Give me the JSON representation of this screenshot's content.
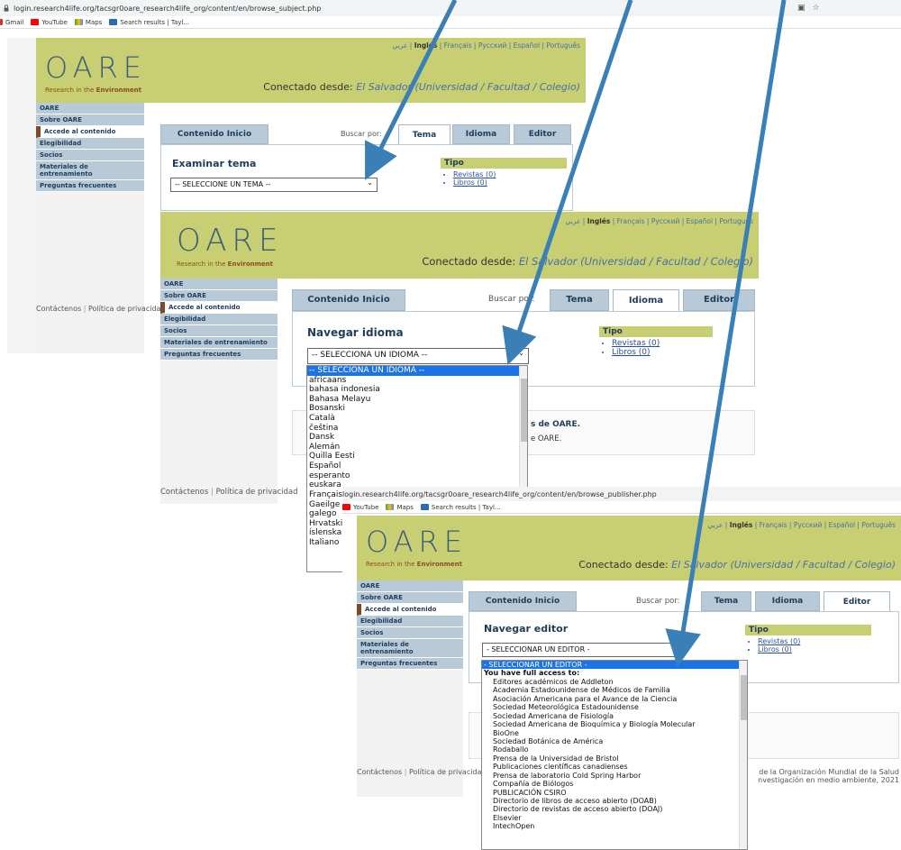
{
  "browser": {
    "url1": "login.research4life.org/tacsgr0oare_research4life_org/content/en/browse_subject.php",
    "url3": "login.research4life.org/tacsgr0oare_research4life_org/content/en/browse_publisher.php",
    "bookmarks": [
      "Gmail",
      "YouTube",
      "Maps",
      "Search results | Tayl..."
    ]
  },
  "brand": {
    "logo": "OARE",
    "tagline_prefix": "Research in the ",
    "tagline_bold": "Environment"
  },
  "languages": {
    "arabic": "عربي",
    "ingles": "Inglés",
    "others": "| Français | Русский | Español | Português"
  },
  "conectado": {
    "label": "Conectado desde:",
    "value": "El Salvador (Universidad / Facultad / Colegio)"
  },
  "sidebar": [
    "OARE",
    "Sobre OARE",
    "Accede al contenido",
    "Elegibilidad",
    "Socios",
    "Materiales de entrenamiento",
    "Preguntas frecuentes"
  ],
  "tabs": {
    "inicio": "Contenido Inicio",
    "buscar": "Buscar por:",
    "tema": "Tema",
    "idioma": "Idioma",
    "editor": "Editor"
  },
  "tipo": {
    "title": "Tipo",
    "revistas": "Revistas (0)",
    "libros": "Libros (0)"
  },
  "screen1": {
    "heading": "Examinar tema",
    "select": "-- SELECCIONE UN TEMA --"
  },
  "screen2": {
    "heading": "Navegar idioma",
    "select": "-- SELECCIONA UN IDIOMA --",
    "options": [
      "-- SELECCIONA UN IDIOMA --",
      "africaans",
      "bahasa indonesia",
      "Bahasa Melayu",
      "Bosanski",
      "Català",
      "čeština",
      "Dansk",
      "Alemán",
      "Quilla Eesti",
      "Español",
      "esperanto",
      "euskara",
      "Française",
      "Gaeilge",
      "galego",
      "Hrvatski",
      "íslenska",
      "Italiano"
    ],
    "partial_text1": "s de OARE.",
    "partial_text2": "e OARE."
  },
  "screen3": {
    "heading": "Navegar editor",
    "select": "- SELECCIONAR UN EDITOR -",
    "options_selected": "- SELECCIONAR UN EDITOR -",
    "group": "You have full access to:",
    "options": [
      "Editores académicos de Addleton",
      "Academia Estadounidense de Médicos de Familia",
      "Asociación Americana para el Avance de la Ciencia",
      "Sociedad Meteorológica Estadounidense",
      "Sociedad Americana de Fisiología",
      "Sociedad Americana de Bioquímica y Biología Molecular",
      "BioOne",
      "Sociedad Botánica de América",
      "Rodaballo",
      "Prensa de la Universidad de Bristol",
      "Publicaciones científicas canadienses",
      "Prensa de laboratorio Cold Spring Harbor",
      "Compañía de Biólogos",
      "PUBLICACIÓN CSIRO",
      "Directorio de libros de acceso abierto (DOAB)",
      "Directorio de revistas de acceso abierto (DOAJ)",
      "Elsevier",
      "IntechOpen"
    ],
    "footer_right1": "de la Organización Mundial de la Salud",
    "footer_right2": "nvestigación en medio ambiente, 2021"
  },
  "footer": {
    "contact": "Contáctenos",
    "privacy": "Política de privacidad",
    "privacy_cut": "Política de privacida"
  },
  "colors": {
    "header": "#c8cf72",
    "nav": "#b8cad8",
    "link": "#4a6fa5",
    "arrow": "#3a7fb5"
  }
}
